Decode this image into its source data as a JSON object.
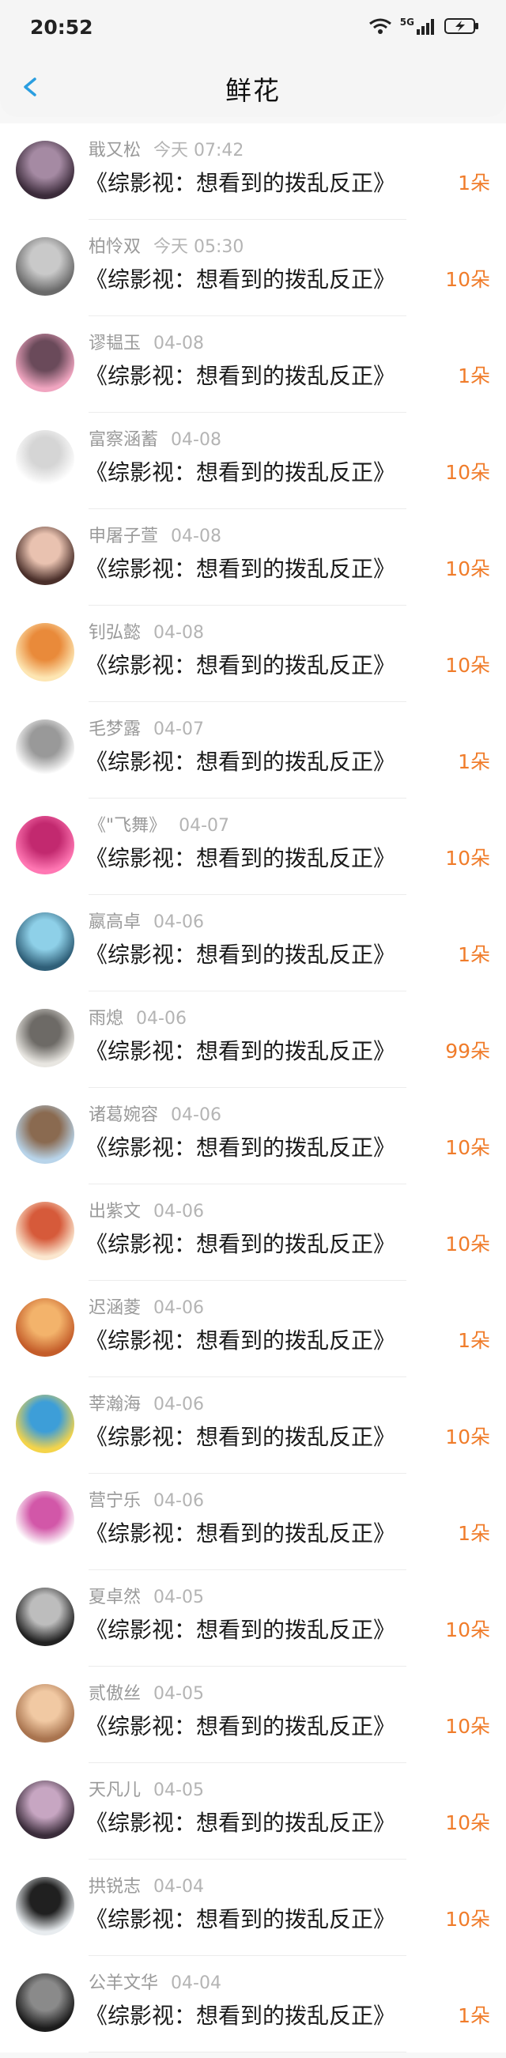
{
  "status": {
    "time": "20:52",
    "network": "5G"
  },
  "nav": {
    "title": "鲜花"
  },
  "colors": {
    "accent": "#2a9ee0",
    "count": "#f07c2a"
  },
  "items": [
    {
      "name": "戢又松",
      "date": "今天 07:42",
      "book": "《综影视：想看到的拨乱反正》",
      "count": "1朵",
      "av": [
        "#3b2b3a",
        "#a58aa3"
      ]
    },
    {
      "name": "柏怜双",
      "date": "今天 05:30",
      "book": "《综影视：想看到的拨乱反正》",
      "count": "10朵",
      "av": [
        "#6a6a6a",
        "#c9c9c9"
      ]
    },
    {
      "name": "谬韫玉",
      "date": "04-08",
      "book": "《综影视：想看到的拨乱反正》",
      "count": "1朵",
      "av": [
        "#f0a5c0",
        "#6a4a5a"
      ]
    },
    {
      "name": "富察涵蓄",
      "date": "04-08",
      "book": "《综影视：想看到的拨乱反正》",
      "count": "10朵",
      "av": [
        "#ffffff",
        "#d5d5d5"
      ]
    },
    {
      "name": "申屠子萱",
      "date": "04-08",
      "book": "《综影视：想看到的拨乱反正》",
      "count": "10朵",
      "av": [
        "#4a2f2a",
        "#e9c2b0"
      ]
    },
    {
      "name": "钊弘懿",
      "date": "04-08",
      "book": "《综影视：想看到的拨乱反正》",
      "count": "10朵",
      "av": [
        "#fde6b3",
        "#e98a3a"
      ]
    },
    {
      "name": "毛梦露",
      "date": "04-07",
      "book": "《综影视：想看到的拨乱反正》",
      "count": "1朵",
      "av": [
        "#ffffff",
        "#999999"
      ]
    },
    {
      "name": "《\"飞舞》",
      "date": "04-07",
      "book": "《综影视：想看到的拨乱反正》",
      "count": "10朵",
      "av": [
        "#ff77b3",
        "#c2296f"
      ]
    },
    {
      "name": "嬴高卓",
      "date": "04-06",
      "book": "《综影视：想看到的拨乱反正》",
      "count": "1朵",
      "av": [
        "#2f5f78",
        "#8ed0e8"
      ]
    },
    {
      "name": "雨熄",
      "date": "04-06",
      "book": "《综影视：想看到的拨乱反正》",
      "count": "99朵",
      "av": [
        "#e8e6e1",
        "#6d6a66"
      ]
    },
    {
      "name": "诸葛婉容",
      "date": "04-06",
      "book": "《综影视：想看到的拨乱反正》",
      "count": "10朵",
      "av": [
        "#b8d4ea",
        "#8a6a50"
      ]
    },
    {
      "name": "出紫文",
      "date": "04-06",
      "book": "《综影视：想看到的拨乱反正》",
      "count": "10朵",
      "av": [
        "#fbe7cf",
        "#d65a3a"
      ]
    },
    {
      "name": "迟涵菱",
      "date": "04-06",
      "book": "《综影视：想看到的拨乱反正》",
      "count": "1朵",
      "av": [
        "#c45d2a",
        "#f3b36b"
      ]
    },
    {
      "name": "莘瀚海",
      "date": "04-06",
      "book": "《综影视：想看到的拨乱反正》",
      "count": "10朵",
      "av": [
        "#f4d44a",
        "#3d9ed8"
      ]
    },
    {
      "name": "营宁乐",
      "date": "04-06",
      "book": "《综影视：想看到的拨乱反正》",
      "count": "1朵",
      "av": [
        "#ffffff",
        "#d257a8"
      ]
    },
    {
      "name": "夏卓然",
      "date": "04-05",
      "book": "《综影视：想看到的拨乱反正》",
      "count": "10朵",
      "av": [
        "#222222",
        "#bdbdbd"
      ]
    },
    {
      "name": "贰傲丝",
      "date": "04-05",
      "book": "《综影视：想看到的拨乱反正》",
      "count": "10朵",
      "av": [
        "#a9744f",
        "#f1c9a3"
      ]
    },
    {
      "name": "天凡儿",
      "date": "04-05",
      "book": "《综影视：想看到的拨乱反正》",
      "count": "10朵",
      "av": [
        "#3a2c3a",
        "#c7a6c2"
      ]
    },
    {
      "name": "拱锐志",
      "date": "04-04",
      "book": "《综影视：想看到的拨乱反正》",
      "count": "10朵",
      "av": [
        "#e8ecef",
        "#202020"
      ]
    },
    {
      "name": "公羊文华",
      "date": "04-04",
      "book": "《综影视：想看到的拨乱反正》",
      "count": "1朵",
      "av": [
        "#1c1c1c",
        "#8a8a8a"
      ]
    }
  ]
}
